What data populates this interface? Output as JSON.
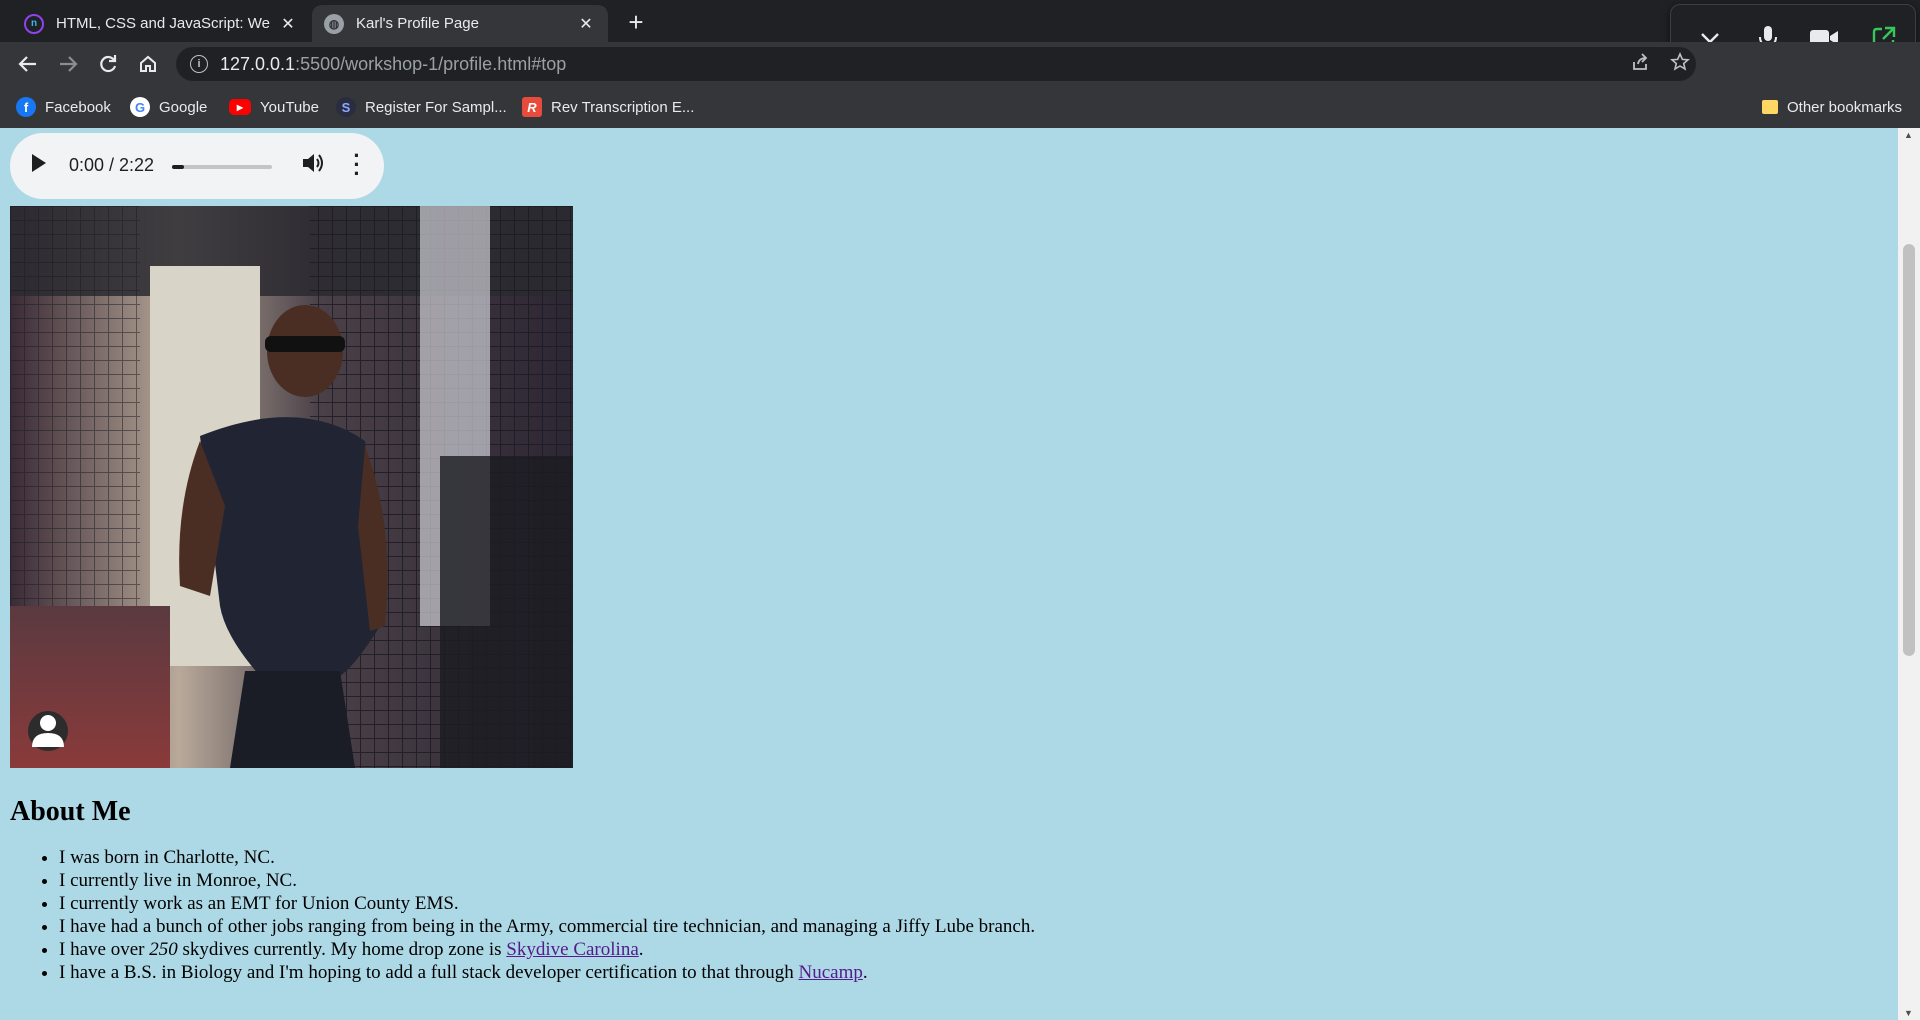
{
  "tabs": [
    {
      "title": "HTML, CSS and JavaScript: Week",
      "favicon": "nucamp-icon",
      "active": false
    },
    {
      "title": "Karl's Profile Page",
      "favicon": "globe-icon",
      "active": true
    }
  ],
  "address": {
    "host": "127.0.0.1",
    "path": ":5500/workshop-1/profile.html#top"
  },
  "bookmarks": [
    {
      "label": "Facebook",
      "icon": "facebook-icon",
      "color": "#1877f2"
    },
    {
      "label": "Google",
      "icon": "google-icon",
      "color": "#4285f4"
    },
    {
      "label": "YouTube",
      "icon": "youtube-icon",
      "color": "#ff0000"
    },
    {
      "label": "Register For Sampl...",
      "icon": "register-icon",
      "color": "#3b5998"
    },
    {
      "label": "Rev Transcription E...",
      "icon": "rev-icon",
      "color": "#e84b3c"
    }
  ],
  "other_bookmarks": "Other bookmarks",
  "audio": {
    "time": "0:00 / 2:22",
    "progress": 0.12
  },
  "about": {
    "heading": "About Me",
    "items": [
      {
        "text": "I was born in Charlotte, NC."
      },
      {
        "text": "I currently live in Monroe, NC."
      },
      {
        "text": "I currently work as an EMT for Union County EMS."
      },
      {
        "text": "I have had a bunch of other jobs ranging from being in the Army, commercial tire technician, and managing a Jiffy Lube branch."
      },
      {
        "pre": "I have over ",
        "em": "250",
        "mid": " skydives currently. My home drop zone is ",
        "link": "Skydive Carolina",
        "post": "."
      },
      {
        "pre": "I have a B.S. in Biology and I'm hoping to add a full stack developer certification to that through ",
        "link": "Nucamp",
        "post": "."
      }
    ]
  },
  "colors": {
    "page_bg": "#add8e6",
    "link_visited": "#551a8b",
    "chrome_dark": "#202124",
    "chrome_mid": "#35363a"
  }
}
